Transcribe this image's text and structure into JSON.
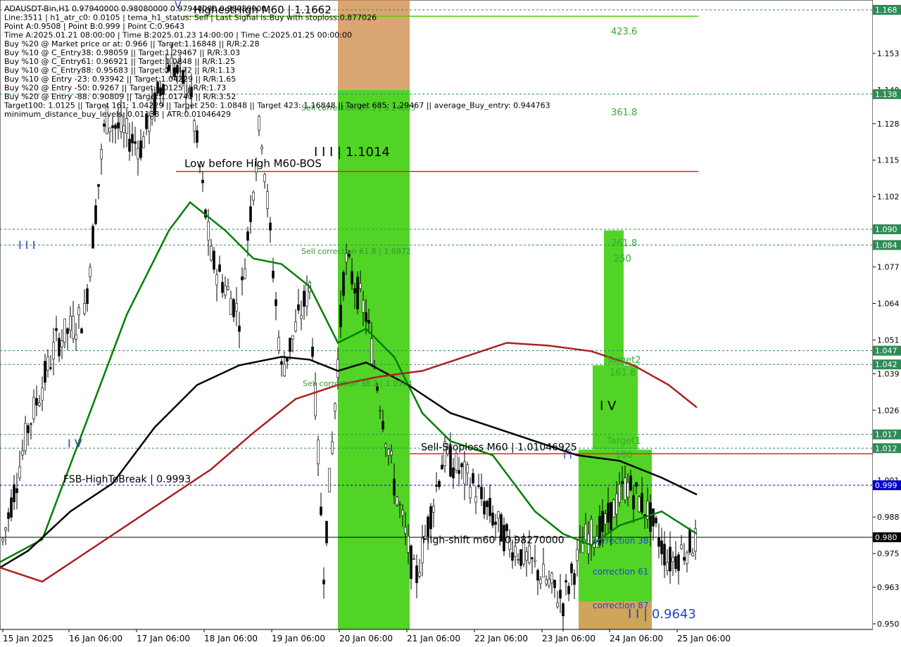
{
  "colors": {
    "background": "#ffffff",
    "plot_bg": "#ffffff",
    "bull": "#000000",
    "bear": "#000000",
    "green_zone": "#33cc00",
    "orange_zone": "#cc8844",
    "red_line": "#ff2200",
    "green_line": "#008000",
    "info_text": "#000000",
    "dashed_blue": "#0000cc"
  },
  "info_lines": [
    "ADAUSDT-Bin,H1  0.97940000 0.98080000 0.97940000 0.98080000",
    "Line:3511 | h1_atr_c0: 0.0105 | tema_h1_status: Sell | Last Signal is:Buy with stoploss:0.877026",
    "Point A:0.9508 | Point B:0.999 | Point C:0.9643",
    "Time A:2025.01.21 08:00:00 | Time B:2025.01.23 14:00:00 | Time C:2025.01.25 00:00:00",
    "Buy %20 @ Market price or at: 0.966 || Target:1.16848 || R/R:2.28",
    "Buy %10 @ C_Entry38: 0.98059 || Target:1.29467 || R/R:3.03",
    "Buy %10 @ C_Entry61: 0.96921 || Target:1.0848 || R/R:1.25",
    "Buy %10 @ C_Entry88: 0.95683 || Target:1.0472 || R/R:1.13",
    "Buy %10 @ Entry -23: 0.93942 || Target:1.04229 || R/R:1.65",
    "Buy %20 @ Entry -50: 0.9267 || Target:1.0125 || R/R:1.73",
    "Buy %20 @ Entry -88: 0.90809 || Target:1.01741 || R/R:3.52",
    "Target100: 1.0125 || Target 161: 1.04229 || Target 250: 1.0848 || Target 423: 1.16848 || Target 685: 1.29467 || average_Buy_entry: 0.944763",
    "minimum_distance_buy_levels: 0.01138 | ATR:0.01046429"
  ],
  "chart_data": {
    "type": "candlestick",
    "symbol": "ADAUSDT-Bin",
    "timeframe": "H1",
    "ylim": [
      0.948,
      1.172
    ],
    "x_labels": [
      "15 Jan 2025",
      "16 Jan 06:00",
      "17 Jan 06:00",
      "18 Jan 06:00",
      "19 Jan 06:00",
      "20 Jan 06:00",
      "21 Jan 06:00",
      "22 Jan 06:00",
      "23 Jan 06:00",
      "24 Jan 06:00",
      "25 Jan 06:00"
    ],
    "y_ticks": [
      "1.153",
      "1.140",
      "1.128",
      "1.115",
      "1.102",
      "1.077",
      "1.064",
      "1.051",
      "1.039",
      "1.026",
      "1.001",
      "0.988",
      "0.975",
      "0.963",
      "0.950"
    ],
    "y_ticks_values": [
      1.153,
      1.14,
      1.128,
      1.115,
      1.102,
      1.077,
      1.064,
      1.051,
      1.039,
      1.026,
      1.001,
      0.988,
      0.975,
      0.963,
      0.95
    ],
    "price_tags": [
      {
        "label": "1.168",
        "value": 1.1685,
        "color": "#2e8b57"
      },
      {
        "label": "1.138",
        "value": 1.1385,
        "color": "#2e8b57"
      },
      {
        "label": "1.090",
        "value": 1.0904,
        "color": "#2e8b57"
      },
      {
        "label": "1.084",
        "value": 1.0848,
        "color": "#2e8b57"
      },
      {
        "label": "1.047",
        "value": 1.0472,
        "color": "#2e8b57"
      },
      {
        "label": "1.042",
        "value": 1.0423,
        "color": "#2e8b57"
      },
      {
        "label": "1.017",
        "value": 1.0174,
        "color": "#2e8b57"
      },
      {
        "label": "1.012",
        "value": 1.0125,
        "color": "#2e8b57"
      },
      {
        "label": "0.999",
        "value": 0.9993,
        "color": "#0000cc"
      },
      {
        "label": "0.980",
        "value": 0.9808,
        "color": "#000000"
      }
    ],
    "levels": [
      {
        "text": "HighestHigh   M60 | 1.1662",
        "value": 1.1662
      },
      {
        "text": "Low before High   M60-BOS",
        "value": 1.111
      },
      {
        "text": "Sell-Stoploss M60 | 1.01046925",
        "value": 1.0105
      },
      {
        "text": "FSB-HighToBreak | 0.9993",
        "value": 0.9993
      },
      {
        "text": "High-shift m60 | 0.98270000",
        "value": 0.9827
      }
    ],
    "zone_labels": [
      "423.6",
      "361.8",
      "261.8",
      "250",
      "Target2",
      "161.8",
      "Target1",
      "100",
      "Sell correction 87.5 | 1.14035",
      "Sell correction 61.8 | 1.0872",
      "Sell correction 38.2 | 1.0364",
      "correction 38",
      "correction 61",
      "correction 87"
    ],
    "wave_labels": [
      "I I I",
      "I V",
      "I I I | 1.1014",
      "I V",
      "I I | 0.9643",
      "V",
      "I I"
    ],
    "close": 0.9808
  }
}
